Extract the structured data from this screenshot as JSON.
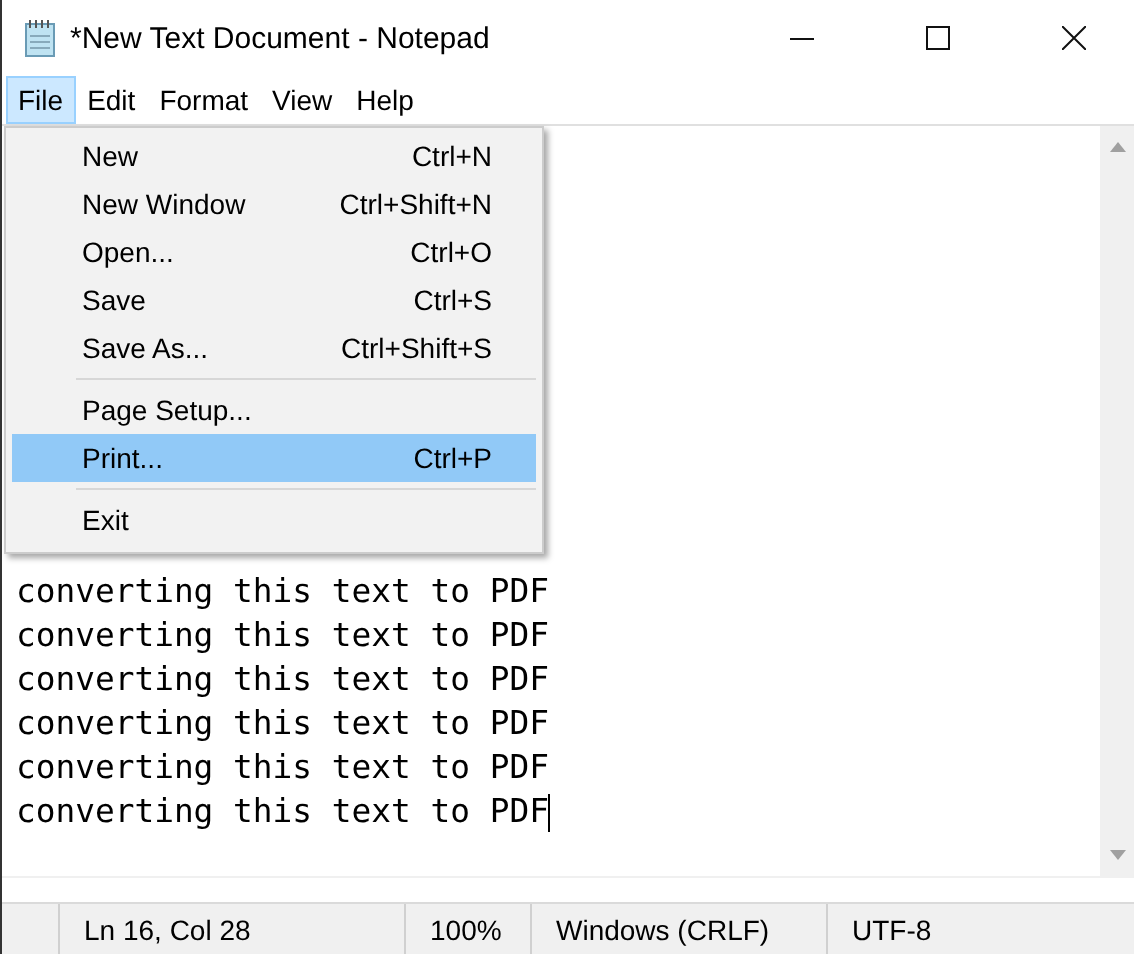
{
  "window": {
    "title": "*New Text Document - Notepad"
  },
  "menu_bar": [
    {
      "label": "File",
      "selected": true
    },
    {
      "label": "Edit",
      "selected": false
    },
    {
      "label": "Format",
      "selected": false
    },
    {
      "label": "View",
      "selected": false
    },
    {
      "label": "Help",
      "selected": false
    }
  ],
  "file_menu": [
    {
      "kind": "item",
      "label": "New",
      "shortcut": "Ctrl+N",
      "selected": false
    },
    {
      "kind": "item",
      "label": "New Window",
      "shortcut": "Ctrl+Shift+N",
      "selected": false
    },
    {
      "kind": "item",
      "label": "Open...",
      "shortcut": "Ctrl+O",
      "selected": false
    },
    {
      "kind": "item",
      "label": "Save",
      "shortcut": "Ctrl+S",
      "selected": false
    },
    {
      "kind": "item",
      "label": "Save As...",
      "shortcut": "Ctrl+Shift+S",
      "selected": false
    },
    {
      "kind": "separator"
    },
    {
      "kind": "item",
      "label": "Page Setup...",
      "selected": false
    },
    {
      "kind": "item",
      "label": "Print...",
      "shortcut": "Ctrl+P",
      "selected": true
    },
    {
      "kind": "separator"
    },
    {
      "kind": "item",
      "label": "Exit",
      "selected": false
    }
  ],
  "document": {
    "lines": [
      "converting this text to PDF",
      "converting this text to PDF",
      "converting this text to PDF",
      "converting this text to PDF",
      "converting this text to PDF",
      "converting this text to PDF"
    ]
  },
  "status_bar": {
    "position": "Ln 16, Col 28",
    "zoom": "100%",
    "line_endings": "Windows (CRLF)",
    "encoding": "UTF-8"
  }
}
